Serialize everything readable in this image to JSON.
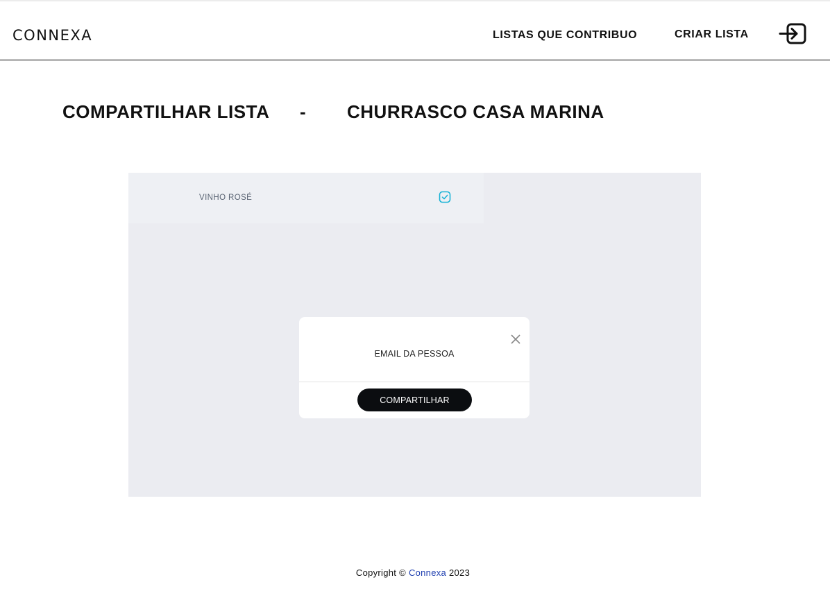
{
  "header": {
    "logo": "CONNEXA",
    "nav": [
      "LISTAS QUE CONTRIBUO",
      "CRIAR LISTA"
    ],
    "login_icon": "login-icon"
  },
  "page": {
    "title_left": "COMPARTILHAR LISTA",
    "separator": "-",
    "title_right": "CHURRASCO CASA MARINA"
  },
  "list": {
    "items": [
      {
        "label": "VINHO ROSÉ",
        "checked": true,
        "icon": "checkbox-checked-icon"
      }
    ],
    "accent_color": "#1ab3d6"
  },
  "modal": {
    "field_label": "EMAIL DA PESSOA",
    "button_label": "COMPARTILHAR",
    "close_icon": "close-icon"
  },
  "footer": {
    "prefix": "Copyright ©",
    "brand": "Connexa",
    "year": "2023",
    "brand_color": "#1f3fb0"
  }
}
